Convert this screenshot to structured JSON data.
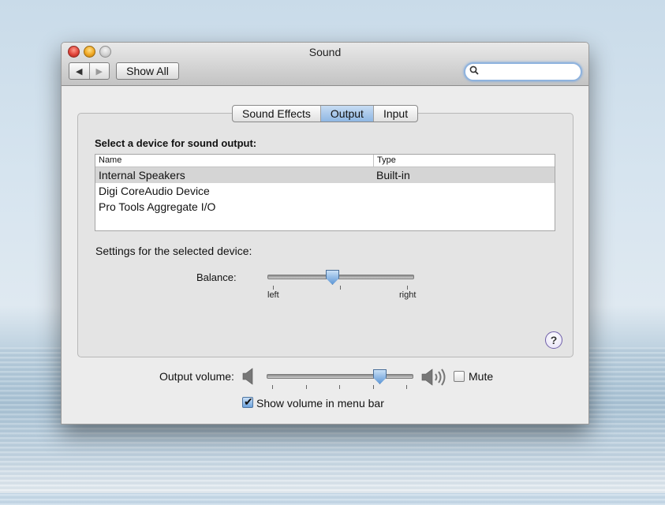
{
  "window": {
    "title": "Sound"
  },
  "toolbar": {
    "back_symbol": "◀",
    "forward_symbol": "▶",
    "show_all_label": "Show All",
    "search_icon": "search-icon",
    "search_value": ""
  },
  "tabs": [
    {
      "label": "Sound Effects",
      "active": false
    },
    {
      "label": "Output",
      "active": true
    },
    {
      "label": "Input",
      "active": false
    }
  ],
  "output": {
    "select_label": "Select a device for sound output:",
    "columns": {
      "name": "Name",
      "type": "Type"
    },
    "devices": [
      {
        "name": "Internal Speakers",
        "type": "Built-in",
        "selected": true
      },
      {
        "name": "Digi CoreAudio Device",
        "type": "",
        "selected": false
      },
      {
        "name": "Pro Tools Aggregate I/O",
        "type": "",
        "selected": false
      }
    ],
    "settings_label": "Settings for the selected device:",
    "balance": {
      "label": "Balance:",
      "left_label": "left",
      "right_label": "right",
      "value": 0.44
    }
  },
  "help": {
    "label": "?"
  },
  "volume": {
    "label": "Output volume:",
    "value": 0.8,
    "low_icon": "speaker-low-icon",
    "high_icon": "speaker-high-icon",
    "mute_label": "Mute",
    "muted": false
  },
  "menu_bar_option": {
    "label": "Show volume in menu bar",
    "checked": true
  },
  "colors": {
    "accent": "#8fb7e3",
    "thumb": "#5f98d6",
    "help_border": "#6f5fa8"
  }
}
